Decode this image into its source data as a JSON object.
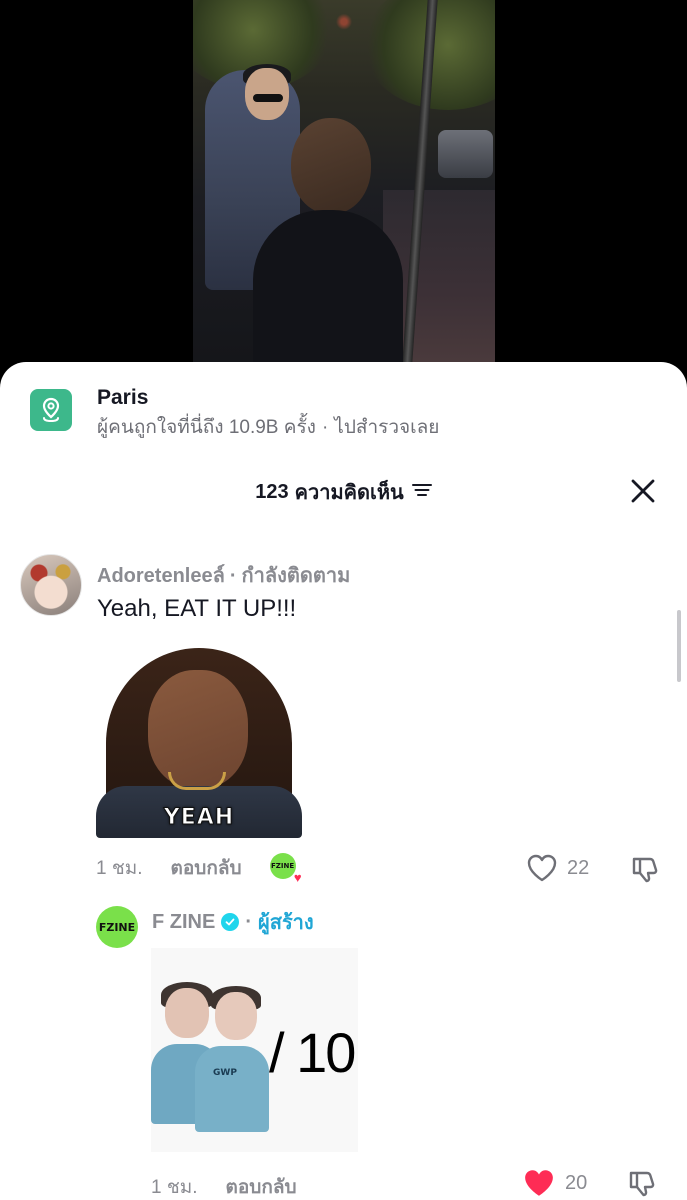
{
  "location": {
    "title": "Paris",
    "stats": "ผู้คนถูกใจที่นี่ถึง 10.9B ครั้ง",
    "separator": "·",
    "explore": "ไปสำรวจเลย"
  },
  "comments_header": {
    "count": "123",
    "label": "ความคิดเห็น"
  },
  "comment": {
    "username": "Adoretenleeล์",
    "separator": "·",
    "following": "กำลังติดตาม",
    "text": "Yeah, EAT IT UP!!!",
    "sticker_text": "YEAH",
    "time": "1 ชม.",
    "reply_label": "ตอบกลับ",
    "creator_mini": "FZINE",
    "likes": "22"
  },
  "reply": {
    "avatar_text": "FZINE",
    "username": "F ZINE",
    "separator": "·",
    "role": "ผู้สร้าง",
    "sticker_text": "/ 10",
    "sticker_shirt_text": "GWP",
    "time": "1 ชม.",
    "reply_label": "ตอบกลับ",
    "likes": "20"
  },
  "colors": {
    "location_icon": "#3db88b",
    "like_active": "#fe2c55",
    "creator_badge": "#20a6d5",
    "verified": "#20d5ec",
    "fzine_green": "#7ae04a"
  }
}
